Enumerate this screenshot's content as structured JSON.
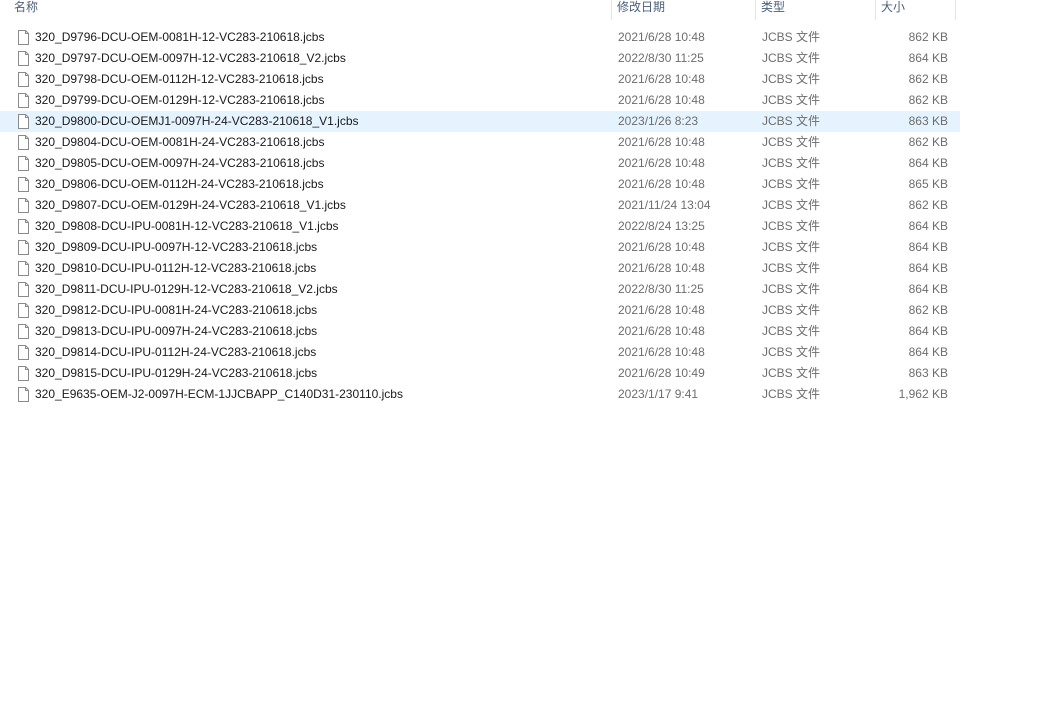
{
  "columns": {
    "name": "名称",
    "date": "修改日期",
    "type": "类型",
    "size": "大小"
  },
  "icon": "file-icon",
  "selected_index": 4,
  "colors": {
    "selection": "#e5f3ff",
    "header_text": "#4c607a",
    "meta_text": "#6d6d6d"
  },
  "files": [
    {
      "name": "320_D9796-DCU-OEM-0081H-12-VC283-210618.jcbs",
      "date": "2021/6/28 10:48",
      "type": "JCBS 文件",
      "size": "862 KB"
    },
    {
      "name": "320_D9797-DCU-OEM-0097H-12-VC283-210618_V2.jcbs",
      "date": "2022/8/30 11:25",
      "type": "JCBS 文件",
      "size": "864 KB"
    },
    {
      "name": "320_D9798-DCU-OEM-0112H-12-VC283-210618.jcbs",
      "date": "2021/6/28 10:48",
      "type": "JCBS 文件",
      "size": "862 KB"
    },
    {
      "name": "320_D9799-DCU-OEM-0129H-12-VC283-210618.jcbs",
      "date": "2021/6/28 10:48",
      "type": "JCBS 文件",
      "size": "862 KB"
    },
    {
      "name": "320_D9800-DCU-OEMJ1-0097H-24-VC283-210618_V1.jcbs",
      "date": "2023/1/26 8:23",
      "type": "JCBS 文件",
      "size": "863 KB"
    },
    {
      "name": "320_D9804-DCU-OEM-0081H-24-VC283-210618.jcbs",
      "date": "2021/6/28 10:48",
      "type": "JCBS 文件",
      "size": "862 KB"
    },
    {
      "name": "320_D9805-DCU-OEM-0097H-24-VC283-210618.jcbs",
      "date": "2021/6/28 10:48",
      "type": "JCBS 文件",
      "size": "864 KB"
    },
    {
      "name": "320_D9806-DCU-OEM-0112H-24-VC283-210618.jcbs",
      "date": "2021/6/28 10:48",
      "type": "JCBS 文件",
      "size": "865 KB"
    },
    {
      "name": "320_D9807-DCU-OEM-0129H-24-VC283-210618_V1.jcbs",
      "date": "2021/11/24 13:04",
      "type": "JCBS 文件",
      "size": "862 KB"
    },
    {
      "name": "320_D9808-DCU-IPU-0081H-12-VC283-210618_V1.jcbs",
      "date": "2022/8/24 13:25",
      "type": "JCBS 文件",
      "size": "864 KB"
    },
    {
      "name": "320_D9809-DCU-IPU-0097H-12-VC283-210618.jcbs",
      "date": "2021/6/28 10:48",
      "type": "JCBS 文件",
      "size": "864 KB"
    },
    {
      "name": "320_D9810-DCU-IPU-0112H-12-VC283-210618.jcbs",
      "date": "2021/6/28 10:48",
      "type": "JCBS 文件",
      "size": "864 KB"
    },
    {
      "name": "320_D9811-DCU-IPU-0129H-12-VC283-210618_V2.jcbs",
      "date": "2022/8/30 11:25",
      "type": "JCBS 文件",
      "size": "864 KB"
    },
    {
      "name": "320_D9812-DCU-IPU-0081H-24-VC283-210618.jcbs",
      "date": "2021/6/28 10:48",
      "type": "JCBS 文件",
      "size": "862 KB"
    },
    {
      "name": "320_D9813-DCU-IPU-0097H-24-VC283-210618.jcbs",
      "date": "2021/6/28 10:48",
      "type": "JCBS 文件",
      "size": "864 KB"
    },
    {
      "name": "320_D9814-DCU-IPU-0112H-24-VC283-210618.jcbs",
      "date": "2021/6/28 10:48",
      "type": "JCBS 文件",
      "size": "864 KB"
    },
    {
      "name": "320_D9815-DCU-IPU-0129H-24-VC283-210618.jcbs",
      "date": "2021/6/28 10:49",
      "type": "JCBS 文件",
      "size": "863 KB"
    },
    {
      "name": "320_E9635-OEM-J2-0097H-ECM-1JJCBAPP_C140D31-230110.jcbs",
      "date": "2023/1/17 9:41",
      "type": "JCBS 文件",
      "size": "1,962 KB"
    }
  ]
}
